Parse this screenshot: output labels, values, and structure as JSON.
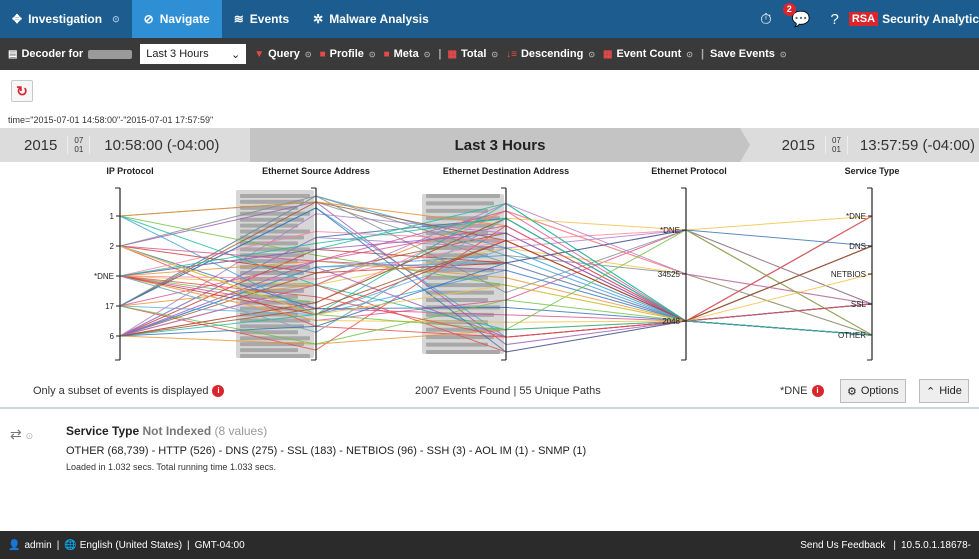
{
  "nav": {
    "tabs": [
      {
        "label": "Investigation",
        "icon": "investigation-icon"
      },
      {
        "label": "Navigate",
        "icon": "navigate-icon"
      },
      {
        "label": "Events",
        "icon": "events-icon"
      },
      {
        "label": "Malware Analysis",
        "icon": "malware-icon"
      }
    ],
    "notification_count": "2",
    "brand_logo": "RSA",
    "brand_name": "Security Analytic"
  },
  "toolbar": {
    "decoder_label": "Decoder for",
    "time_range": "Last 3 Hours",
    "query": "Query",
    "profile": "Profile",
    "meta": "Meta",
    "total": "Total",
    "descending": "Descending",
    "event_count": "Event Count",
    "save_events": "Save Events"
  },
  "query_text": "time=\"2015-07-01 14:58:00\"-\"2015-07-01 17:57:59\"",
  "timeline": {
    "start_year": "2015",
    "start_month": "07",
    "start_day": "01",
    "start_time": "10:58:00 (-04:00)",
    "label": "Last 3 Hours",
    "end_year": "2015",
    "end_month": "07",
    "end_day": "01",
    "end_time": "13:57:59 (-04:00)"
  },
  "chart_data": {
    "type": "parallel-coordinates",
    "axes": [
      {
        "name": "IP Protocol",
        "ticks": [
          "1",
          "2",
          "*DNE",
          "17",
          "6"
        ]
      },
      {
        "name": "Ethernet Source Address",
        "ticks": []
      },
      {
        "name": "Ethernet Destination Address",
        "ticks": []
      },
      {
        "name": "Ethernet Protocol",
        "ticks": [
          "*DNE",
          "34525",
          "2048"
        ]
      },
      {
        "name": "Service Type",
        "ticks": [
          "*DNE",
          "DNS",
          "NETBIOS",
          "SSL",
          "OTHER"
        ]
      }
    ],
    "events_found": 2007,
    "unique_paths": 55
  },
  "chart_footer": {
    "subset_note": "Only a subset of events is displayed",
    "events_summary": "2007 Events Found | 55 Unique Paths",
    "dne_label": "*DNE",
    "options_label": "Options",
    "hide_label": "Hide"
  },
  "meta_panel": {
    "title": "Service Type",
    "not_indexed": "Not Indexed",
    "count": "(8 values)",
    "values": "OTHER (68,739) - HTTP (526) - DNS (275) - SSL (183) - NETBIOS (96) - SSH (3) - AOL IM (1) - SNMP (1)",
    "loaded": "Loaded in 1.032 secs. Total running time 1.033 secs."
  },
  "status_bar": {
    "user": "admin",
    "language": "English (United States)",
    "timezone": "GMT-04:00",
    "feedback": "Send Us Feedback",
    "version": "10.5.0.1.18678-"
  }
}
